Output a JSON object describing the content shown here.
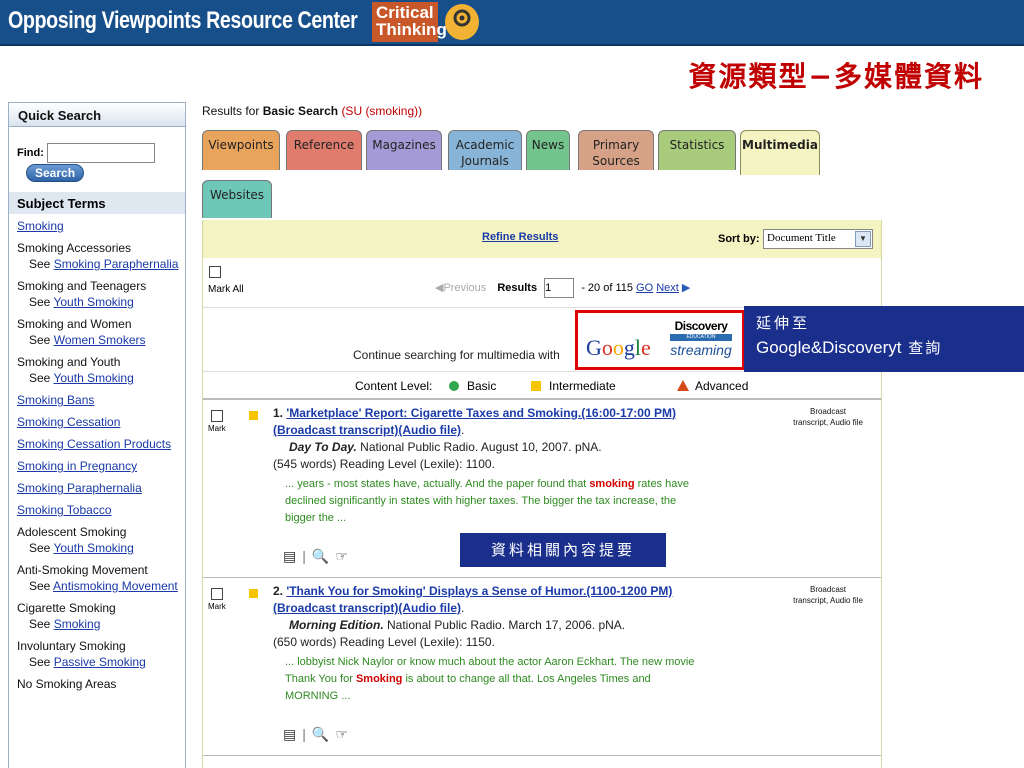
{
  "header": {
    "app_title": "Opposing Viewpoints Resource Center",
    "logo_text": "Critical Thinking"
  },
  "slide_title": "資源類型−多媒體資料",
  "sidebar": {
    "quick_search": "Quick Search",
    "find_label": "Find:",
    "find_value": "",
    "search_button": "Search",
    "subject_terms": "Subject Terms",
    "items": [
      {
        "label": "Smoking",
        "link": true
      },
      {
        "label": "Smoking Accessories",
        "see": "See",
        "see_link": "Smoking Paraphernalia"
      },
      {
        "label": "Smoking and Teenagers",
        "see": "See",
        "see_link": "Youth Smoking"
      },
      {
        "label": "Smoking and Women",
        "see": "See",
        "see_link": "Women Smokers"
      },
      {
        "label": "Smoking and Youth",
        "see": "See",
        "see_link": "Youth Smoking"
      },
      {
        "label": "Smoking Bans",
        "link": true
      },
      {
        "label": "Smoking Cessation",
        "link": true
      },
      {
        "label": "Smoking Cessation Products",
        "link": true
      },
      {
        "label": "Smoking in Pregnancy",
        "link": true
      },
      {
        "label": "Smoking Paraphernalia",
        "link": true
      },
      {
        "label": "Smoking Tobacco",
        "link": true
      },
      {
        "label": "Adolescent Smoking",
        "see": "See",
        "see_link": "Youth Smoking"
      },
      {
        "label": "Anti-Smoking Movement",
        "see": "See",
        "see_link": "Antismoking Movement"
      },
      {
        "label": "Cigarette Smoking",
        "see": "See",
        "see_link": "Smoking"
      },
      {
        "label": "Involuntary Smoking",
        "see": "See",
        "see_link": "Passive Smoking"
      },
      {
        "label": "No Smoking Areas",
        "link": false
      }
    ]
  },
  "main": {
    "results_for_prefix": "Results for",
    "results_for_type": "Basic Search",
    "results_for_query": "(SU (smoking))",
    "tabs": [
      "Viewpoints",
      "Reference",
      "Magazines",
      "Academic Journals",
      "News",
      "Primary Sources",
      "Statistics",
      "Multimedia",
      "Websites"
    ],
    "refine": "Refine Results",
    "sort_label": "Sort by:",
    "sort_value": "Document Title",
    "mark_all": "Mark All",
    "previous": "Previous",
    "results_label": "Results",
    "page_value": "1",
    "range_text": "- 20 of 115",
    "go": "GO",
    "next": "Next",
    "continue_text": "Continue searching for multimedia with",
    "google": "Google",
    "discovery_1": "Discovery",
    "discovery_2": "EDUCATION",
    "discovery_3": "streaming",
    "content_level": "Content Level:",
    "basic": "Basic",
    "intermediate": "Intermediate",
    "advanced": "Advanced"
  },
  "results": [
    {
      "mark": "Mark",
      "num": "1.",
      "title": "'Marketplace' Report: Cigarette Taxes and Smoking.(16:00-17:00 PM)(Broadcast transcript)(Audio file)",
      "show": "Day To Day.",
      "source": "National Public Radio. August 10, 2007. pNA.",
      "meta": "(545 words)  Reading Level (Lexile): 1100.",
      "abstract_before": "... years - most states have, actually. And the paper found that ",
      "abstract_hit": "smoking",
      "abstract_after": " rates have declined significantly in states with higher taxes. The bigger the tax increase, the bigger the ...",
      "doctype": "Broadcast transcript, Audio file"
    },
    {
      "mark": "Mark",
      "num": "2.",
      "title": "'Thank You for Smoking' Displays a Sense of Humor.(1100-1200 PM)(Broadcast transcript)(Audio file)",
      "show": "Morning Edition.",
      "source": "National Public Radio. March 17, 2006. pNA.",
      "meta": "(650 words)  Reading Level (Lexile): 1150.",
      "abstract_before": "... lobbyist Nick Naylor or know much about the actor Aaron Eckhart. The new movie Thank You for ",
      "abstract_hit": "Smoking",
      "abstract_after": " is about to change all that. Los Angeles Times and MORNING ...",
      "doctype": "Broadcast transcript, Audio file"
    }
  ],
  "callouts": {
    "extend_1": "延伸至",
    "extend_2a": "Google&Discoveryt",
    "extend_2b": " 查詢",
    "summary": "資料相關內容提要"
  }
}
